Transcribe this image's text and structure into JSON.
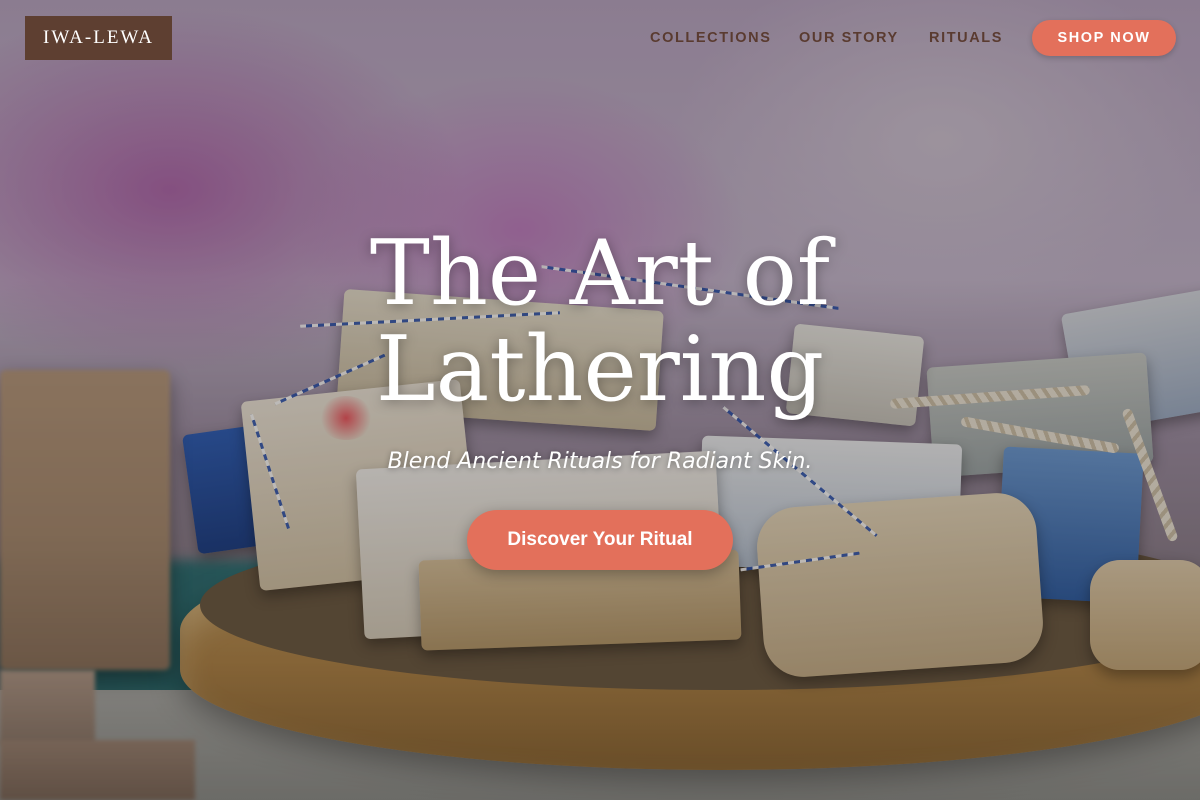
{
  "brand": {
    "logo_text": "IWA-LEWA"
  },
  "nav": {
    "items": [
      {
        "label": "COLLECTIONS"
      },
      {
        "label": "OUR STORY"
      },
      {
        "label": "RITUALS"
      }
    ],
    "cta_label": "SHOP NOW"
  },
  "hero": {
    "title": "The Art of Lathering",
    "subtitle": "Blend Ancient Rituals for Radiant Skin.",
    "cta_label": "Discover Your Ritual",
    "background_description_icon": "handmade-soap-bars-photo"
  },
  "colors": {
    "accent": "#e3705b",
    "brand_dark": "#5e3f31",
    "nav_text": "#5a3b30"
  }
}
